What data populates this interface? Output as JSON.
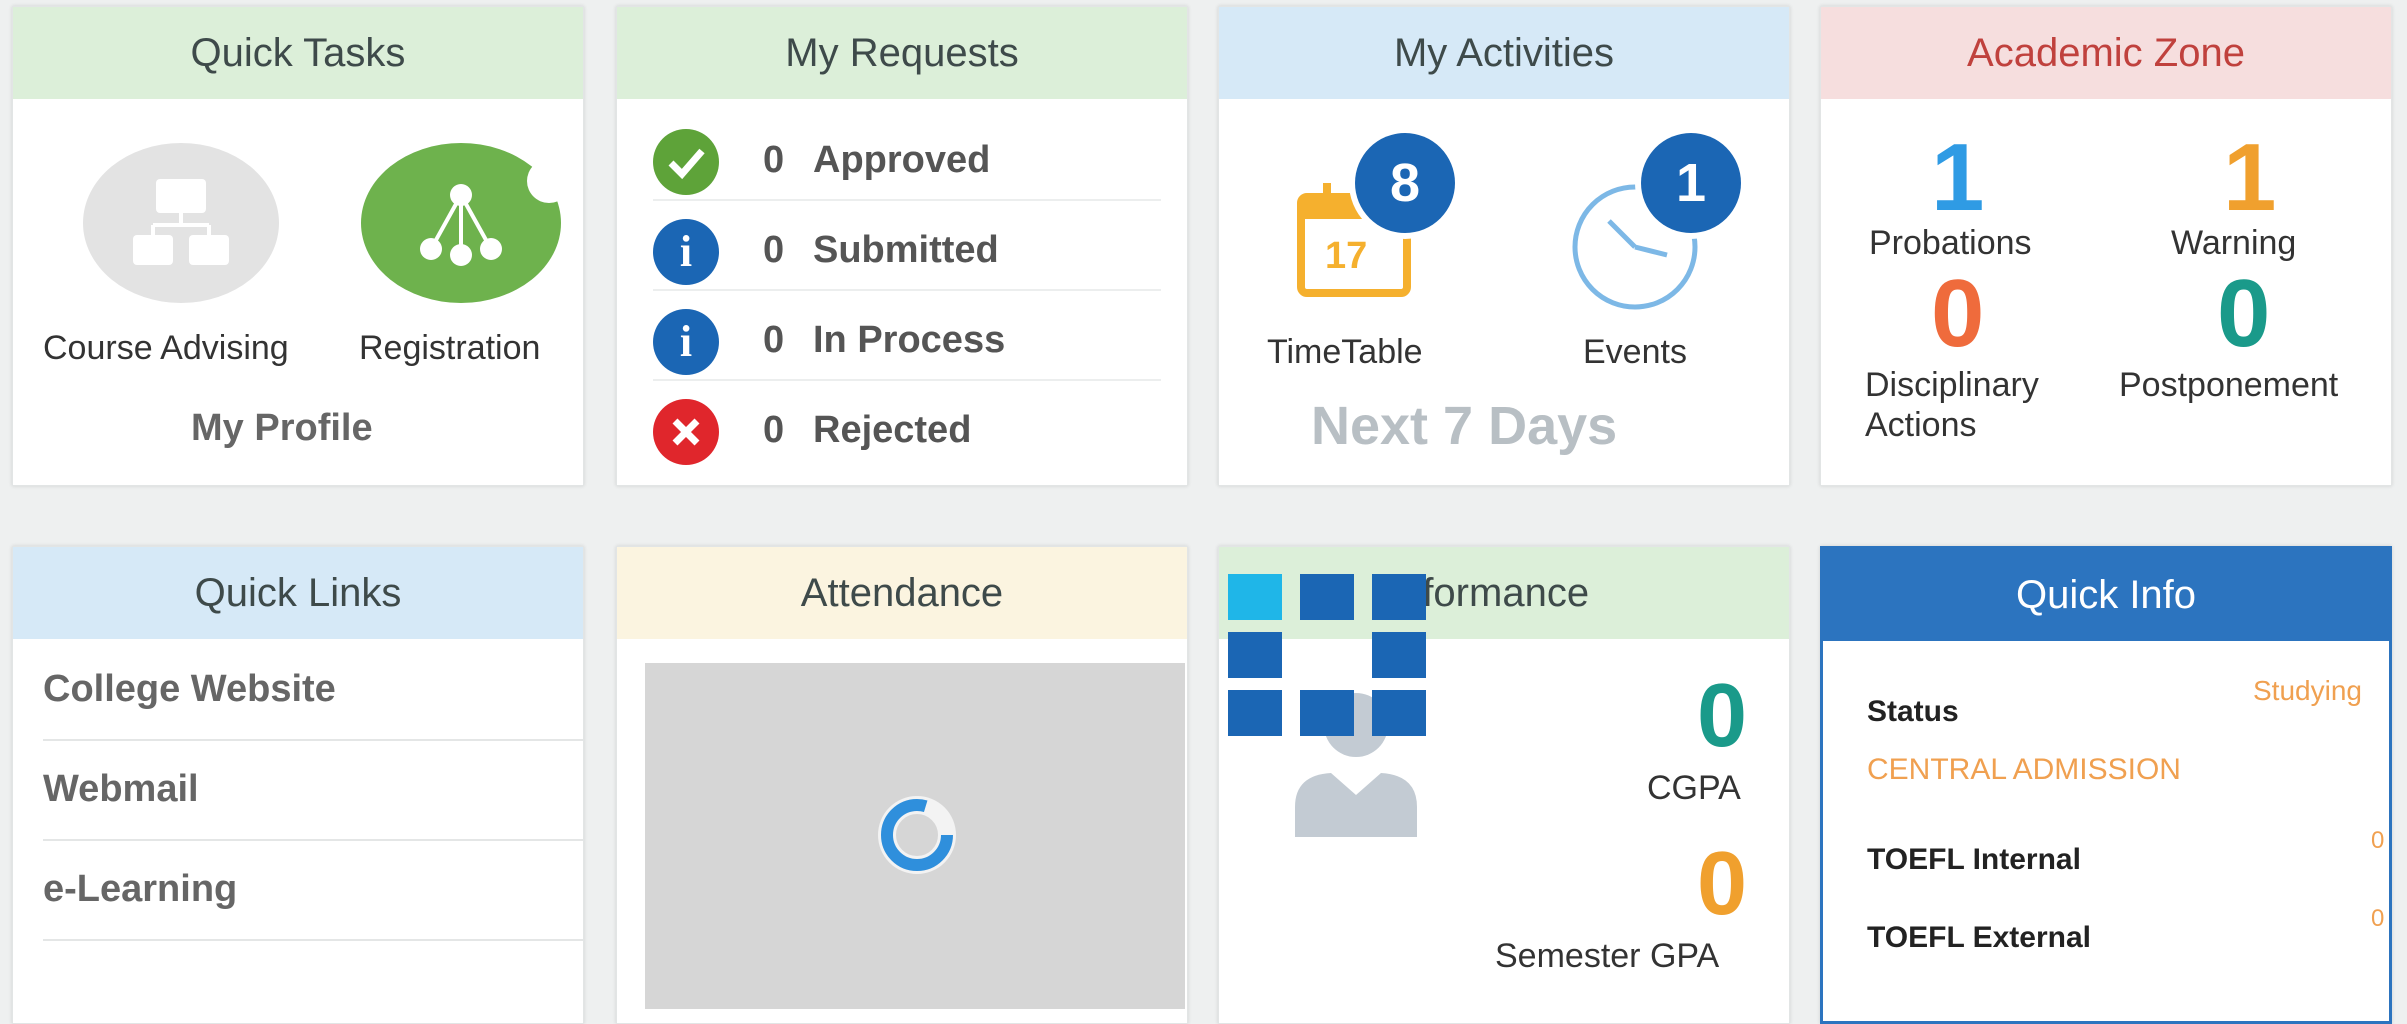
{
  "quick_tasks": {
    "title": "Quick Tasks",
    "items": [
      {
        "label": "Course Advising",
        "icon": "sitemap-icon"
      },
      {
        "label": "Registration",
        "icon": "network-icon"
      }
    ],
    "profile_label": "My Profile"
  },
  "my_requests": {
    "title": "My Requests",
    "items": [
      {
        "count": "0",
        "label": "Approved",
        "icon": "check-icon",
        "color": "#5ea339"
      },
      {
        "count": "0",
        "label": "Submitted",
        "icon": "info-icon",
        "color": "#1b66b4"
      },
      {
        "count": "0",
        "label": "In Process",
        "icon": "info-icon",
        "color": "#1b66b4"
      },
      {
        "count": "0",
        "label": "Rejected",
        "icon": "close-icon",
        "color": "#e0262c"
      }
    ]
  },
  "my_activities": {
    "title": "My Activities",
    "timetable": {
      "label": "TimeTable",
      "badge": "8",
      "calendar_day": "17"
    },
    "events": {
      "label": "Events",
      "badge": "1"
    },
    "footer": "Next 7 Days"
  },
  "academic_zone": {
    "title": "Academic Zone",
    "items": [
      {
        "value": "1",
        "label": "Probations",
        "color": "#2f9be4"
      },
      {
        "value": "1",
        "label": "Warning",
        "color": "#f0a02e"
      },
      {
        "value": "0",
        "label": "Disciplinary Actions",
        "color": "#ef6b3c"
      },
      {
        "value": "0",
        "label": "Postponement",
        "color": "#1a9a8a"
      }
    ]
  },
  "quick_links": {
    "title": "Quick Links",
    "items": [
      "College Website",
      "Webmail",
      "e-Learning"
    ]
  },
  "attendance": {
    "title": "Attendance"
  },
  "performance": {
    "title": "rformance",
    "cgpa": {
      "value": "0",
      "label": "CGPA",
      "color": "#1a9a8a"
    },
    "semester_gpa": {
      "value": "0",
      "label": "Semester GPA",
      "color": "#f0a02e"
    }
  },
  "quick_info": {
    "title": "Quick Info",
    "status_label": "Status",
    "status_value": "Studying",
    "admission": "CENTRAL ADMISSION",
    "toefl_internal_label": "TOEFL Internal",
    "toefl_internal_value": "0",
    "toefl_external_label": "TOEFL External",
    "toefl_external_value": "0"
  },
  "colors": {
    "accent_blue": "#1b66b4",
    "quick_info_header": "#2c74bf"
  }
}
